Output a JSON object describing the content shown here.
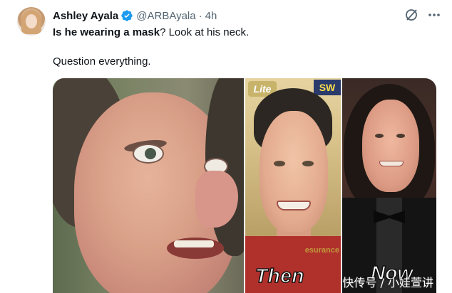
{
  "tweet": {
    "author_name": "Ashley Ayala",
    "handle": "@ARBAyala",
    "separator": "·",
    "timestamp": "4h",
    "text_bold": "Is he wearing a mask",
    "text_rest": "? Look at his neck.",
    "text_line2": "Question everything."
  },
  "media": {
    "label_then": "Then",
    "label_now": "Now",
    "sign_lite": "Lite",
    "sign_sw": "SW",
    "sign_bottom": "esurance",
    "watermark": "快传号 / 小娃萱讲"
  },
  "icons": {
    "verified": "verified-badge-icon",
    "grok": "grok-icon",
    "more": "more-options-icon"
  },
  "colors": {
    "verified_blue": "#1d9bf0",
    "text_primary": "#0f1419",
    "text_secondary": "#536471"
  }
}
